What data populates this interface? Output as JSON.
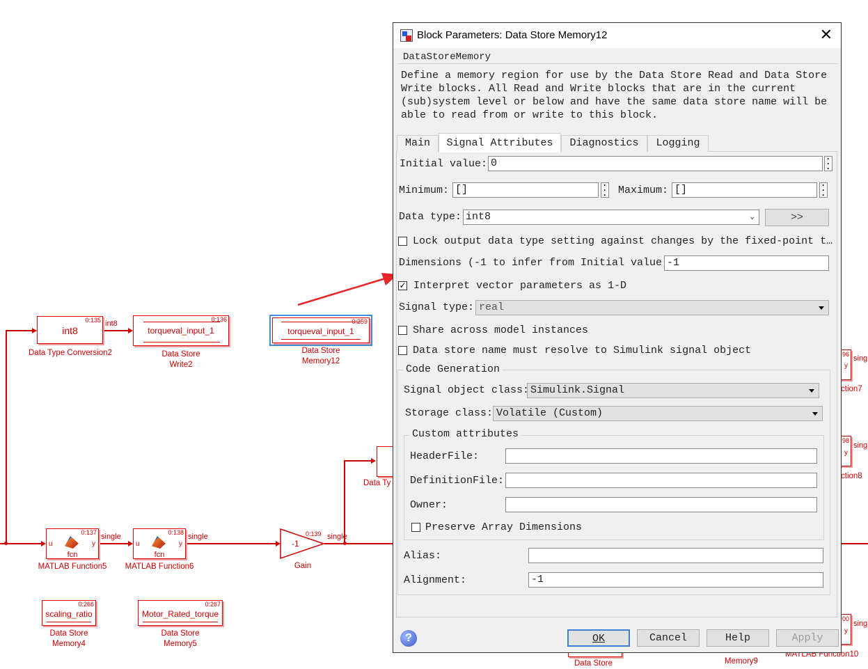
{
  "canvas": {
    "blocks": {
      "dtc2": {
        "text": "int8",
        "id": "0:135",
        "caption": "Data Type Conversion2",
        "out_label": "int8"
      },
      "dsw2": {
        "text": "torqueval_input_1",
        "id": "0:136",
        "caption": [
          "Data Store",
          "Write2"
        ]
      },
      "dsm12": {
        "text": "torqueval_input_1",
        "id": "0:259",
        "caption": [
          "Data Store",
          "Memory12"
        ]
      },
      "mf5": {
        "text": "fcn",
        "id": "0:137",
        "in": "u",
        "out": "y",
        "caption": "MATLAB Function5",
        "out_label": "single"
      },
      "mf6": {
        "text": "fcn",
        "id": "0:138",
        "in": "u",
        "out": "y",
        "caption": "MATLAB Function6",
        "out_label": "single"
      },
      "gain": {
        "text": "-1",
        "id": "0:139",
        "caption": "Gain",
        "out_label": "single"
      },
      "dsm4": {
        "text": "scaling_ratio",
        "id": "0:266",
        "caption": [
          "Data Store",
          "Memory4"
        ]
      },
      "dsm5": {
        "text": "Motor_Rated_torque",
        "id": "0:267",
        "caption": [
          "Data Store",
          "Memory5"
        ]
      },
      "partial_dt": {
        "caption": "Data Ty"
      },
      "right_labels": [
        "96",
        "y",
        "sing",
        "ction7",
        "98",
        "y",
        "sing",
        "ction8",
        "00",
        "y",
        "sing",
        "MATLAB Function10",
        "Data Store",
        "Memory9",
        "Data Store"
      ]
    }
  },
  "dialog": {
    "title": "Block Parameters: Data Store Memory12",
    "block_type": "DataStoreMemory",
    "description": "Define a memory region for use by the Data Store Read and Data Store Write blocks. All Read and Write blocks that are in the current (sub)system level or below and have the same data store name will be able to read from or write to this block.",
    "tabs": [
      "Main",
      "Signal Attributes",
      "Diagnostics",
      "Logging"
    ],
    "active_tab": "Signal Attributes",
    "initial_value_label": "Initial value:",
    "initial_value": "0",
    "minimum_label": "Minimum:",
    "minimum": "[]",
    "maximum_label": "Maximum:",
    "maximum": "[]",
    "data_type_label": "Data type:",
    "data_type": "int8",
    "assistant_button": ">>",
    "lock_label": "Lock output data type setting against changes by the fixed-point t…",
    "lock_checked": false,
    "dimensions_label": "Dimensions (-1 to infer from Initial value):",
    "dimensions": "-1",
    "interpret_label": "Interpret vector parameters as 1-D",
    "interpret_checked": true,
    "signal_type_label": "Signal type:",
    "signal_type": "real",
    "share_label": "Share across model instances",
    "share_checked": false,
    "resolve_label": "Data store name must resolve to Simulink signal object",
    "resolve_checked": false,
    "code_gen": {
      "title": "Code Generation",
      "signal_object_class_label": "Signal object class:",
      "signal_object_class": "Simulink.Signal",
      "storage_class_label": "Storage class:",
      "storage_class": "Volatile (Custom)",
      "custom_title": "Custom attributes",
      "header_file_label": "HeaderFile:",
      "header_file": "",
      "definition_file_label": "DefinitionFile:",
      "definition_file": "",
      "owner_label": "Owner:",
      "owner": "",
      "preserve_label": "Preserve Array Dimensions",
      "preserve_checked": false,
      "alias_label": "Alias:",
      "alias": "",
      "alignment_label": "Alignment:",
      "alignment": "-1"
    },
    "buttons": {
      "ok": "OK",
      "cancel": "Cancel",
      "help": "Help",
      "apply": "Apply"
    },
    "colors": {
      "block_red": "#d00000",
      "highlight": "#3c8ddc",
      "annotation_arrow": "#e8262a"
    }
  }
}
